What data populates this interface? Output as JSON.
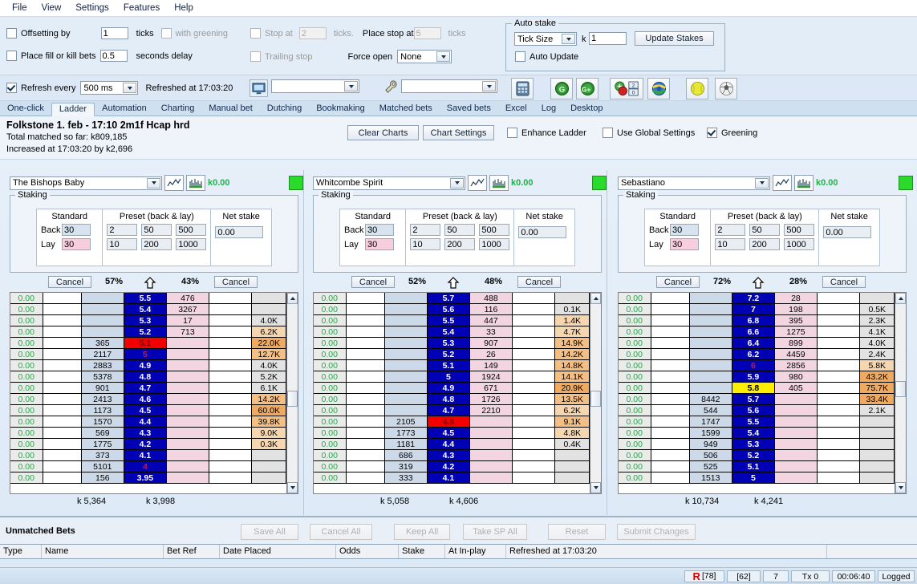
{
  "menu": [
    "File",
    "View",
    "Settings",
    "Features",
    "Help"
  ],
  "options": {
    "offsetting_label": "Offsetting by",
    "offsetting_value": "1",
    "ticks_label": "ticks",
    "with_greening_label": "with greening",
    "fillkill_label": "Place fill or kill bets",
    "fillkill_value": "0.5",
    "seconds_delay_label": "seconds delay",
    "stop_at_label": "Stop at",
    "stop_at_value": "2",
    "ticks_label2": "ticks.",
    "place_stop_label": "Place stop at",
    "place_stop_value": "5",
    "ticks_label3": "ticks",
    "trailing_stop_label": "Trailing stop",
    "force_open_label": "Force open",
    "force_open_value": "None"
  },
  "auto_stake": {
    "caption": "Auto stake",
    "mode": "Tick Size",
    "k_label": "k",
    "k_value": "1",
    "update_button": "Update Stakes",
    "auto_update_label": "Auto Update"
  },
  "refresh": {
    "refresh_every_label": "Refresh every",
    "interval": "500 ms",
    "refreshed_label": "Refreshed at 17:03:20",
    "combo1": "",
    "combo2": ""
  },
  "toolbar_icons": [
    "calculator-icon",
    "greening-g-icon",
    "greening-gplus-icon",
    "back-lay-icon",
    "stack-2-icon",
    "stack-0-icon",
    "globe-icon",
    "tennis-ball-icon",
    "football-icon"
  ],
  "tabs": [
    {
      "label": "One-click",
      "selected": false
    },
    {
      "label": "Ladder",
      "selected": true
    },
    {
      "label": "Automation",
      "selected": false
    },
    {
      "label": "Charting",
      "selected": false
    },
    {
      "label": "Manual bet",
      "selected": false
    },
    {
      "label": "Dutching",
      "selected": false
    },
    {
      "label": "Bookmaking",
      "selected": false
    },
    {
      "label": "Matched bets",
      "selected": false
    },
    {
      "label": "Saved bets",
      "selected": false
    },
    {
      "label": "Excel",
      "selected": false
    },
    {
      "label": "Log",
      "selected": false
    },
    {
      "label": "Desktop",
      "selected": false
    }
  ],
  "market": {
    "title": "Folkstone 1. feb - 17:10 2m1f Hcap hrd",
    "total_matched": "Total matched so far: k809,185",
    "increased": "Increased at 17:03:20 by k2,696",
    "clear_charts": "Clear Charts",
    "chart_settings": "Chart Settings",
    "enhance_ladder": "Enhance Ladder",
    "use_global_settings": "Use Global Settings",
    "greening": "Greening"
  },
  "staking_labels": {
    "caption": "Staking",
    "standard": "Standard",
    "preset": "Preset (back & lay)",
    "net_stake": "Net stake",
    "back": "Back",
    "lay": "Lay",
    "cancel": "Cancel"
  },
  "ladders": [
    {
      "selection": "The Bishops Baby",
      "pl": "k0.00",
      "back_pct": "57%",
      "lay_pct": "43%",
      "total_back": "k 5,364",
      "total_lay": "k 3,998",
      "staking": {
        "back": "30",
        "lay": "30",
        "p1": "2",
        "p2": "50",
        "p3": "500",
        "p4": "10",
        "p5": "200",
        "p6": "1000",
        "net": "0.00"
      },
      "rows": [
        {
          "pl": "0.00",
          "b2": "",
          "backq": "",
          "odds": "5.5",
          "layq": "476",
          "l2": "",
          "vol": "",
          "state": "blue",
          "volshade": 0
        },
        {
          "pl": "0.00",
          "b2": "",
          "backq": "",
          "odds": "5.4",
          "layq": "3267",
          "l2": "",
          "vol": "",
          "state": "blue",
          "volshade": 0
        },
        {
          "pl": "0.00",
          "b2": "",
          "backq": "",
          "odds": "5.3",
          "layq": "17",
          "l2": "",
          "vol": "4.0K",
          "state": "blue",
          "volshade": 0
        },
        {
          "pl": "0.00",
          "b2": "",
          "backq": "",
          "odds": "5.2",
          "layq": "713",
          "l2": "",
          "vol": "6.2K",
          "state": "blue",
          "volshade": 1
        },
        {
          "pl": "0.00",
          "b2": "",
          "backq": "365",
          "odds": "5.1",
          "layq": "",
          "l2": "",
          "vol": "22.0K",
          "state": "red",
          "volshade": 3
        },
        {
          "pl": "0.00",
          "b2": "",
          "backq": "2117",
          "odds": "5",
          "layq": "",
          "l2": "",
          "vol": "12.7K",
          "state": "mag",
          "volshade": 2
        },
        {
          "pl": "0.00",
          "b2": "",
          "backq": "2883",
          "odds": "4.9",
          "layq": "",
          "l2": "",
          "vol": "4.0K",
          "state": "blue",
          "volshade": 0
        },
        {
          "pl": "0.00",
          "b2": "",
          "backq": "5378",
          "odds": "4.8",
          "layq": "",
          "l2": "",
          "vol": "5.2K",
          "state": "blue",
          "volshade": 0
        },
        {
          "pl": "0.00",
          "b2": "",
          "backq": "901",
          "odds": "4.7",
          "layq": "",
          "l2": "",
          "vol": "6.1K",
          "state": "blue",
          "volshade": 0
        },
        {
          "pl": "0.00",
          "b2": "",
          "backq": "2413",
          "odds": "4.6",
          "layq": "",
          "l2": "",
          "vol": "14.2K",
          "state": "blue",
          "volshade": 2
        },
        {
          "pl": "0.00",
          "b2": "",
          "backq": "1173",
          "odds": "4.5",
          "layq": "",
          "l2": "",
          "vol": "60.0K",
          "state": "blue",
          "volshade": 3
        },
        {
          "pl": "0.00",
          "b2": "",
          "backq": "1570",
          "odds": "4.4",
          "layq": "",
          "l2": "",
          "vol": "39.8K",
          "state": "blue",
          "volshade": 2
        },
        {
          "pl": "0.00",
          "b2": "",
          "backq": "569",
          "odds": "4.3",
          "layq": "",
          "l2": "",
          "vol": "9.0K",
          "state": "blue",
          "volshade": 1
        },
        {
          "pl": "0.00",
          "b2": "",
          "backq": "1775",
          "odds": "4.2",
          "layq": "",
          "l2": "",
          "vol": "0.3K",
          "state": "blue",
          "volshade": 1
        },
        {
          "pl": "0.00",
          "b2": "",
          "backq": "373",
          "odds": "4.1",
          "layq": "",
          "l2": "",
          "vol": "",
          "state": "blue",
          "volshade": 0
        },
        {
          "pl": "0.00",
          "b2": "",
          "backq": "5101",
          "odds": "4",
          "layq": "",
          "l2": "",
          "vol": "",
          "state": "mag",
          "volshade": 0
        },
        {
          "pl": "0.00",
          "b2": "",
          "backq": "156",
          "odds": "3.95",
          "layq": "",
          "l2": "",
          "vol": "",
          "state": "blue",
          "volshade": 0
        }
      ]
    },
    {
      "selection": "Whitcombe Spirit",
      "pl": "k0.00",
      "back_pct": "52%",
      "lay_pct": "48%",
      "total_back": "k 5,058",
      "total_lay": "k 4,606",
      "staking": {
        "back": "30",
        "lay": "30",
        "p1": "2",
        "p2": "50",
        "p3": "500",
        "p4": "10",
        "p5": "200",
        "p6": "1000",
        "net": "0.00"
      },
      "rows": [
        {
          "pl": "0.00",
          "b2": "",
          "backq": "",
          "odds": "5.7",
          "layq": "488",
          "l2": "",
          "vol": "",
          "state": "blue",
          "volshade": 0
        },
        {
          "pl": "0.00",
          "b2": "",
          "backq": "",
          "odds": "5.6",
          "layq": "116",
          "l2": "",
          "vol": "0.1K",
          "state": "blue",
          "volshade": 0
        },
        {
          "pl": "0.00",
          "b2": "",
          "backq": "",
          "odds": "5.5",
          "layq": "447",
          "l2": "",
          "vol": "1.4K",
          "state": "blue",
          "volshade": 1
        },
        {
          "pl": "0.00",
          "b2": "",
          "backq": "",
          "odds": "5.4",
          "layq": "33",
          "l2": "",
          "vol": "4.7K",
          "state": "blue",
          "volshade": 1
        },
        {
          "pl": "0.00",
          "b2": "",
          "backq": "",
          "odds": "5.3",
          "layq": "907",
          "l2": "",
          "vol": "14.9K",
          "state": "blue",
          "volshade": 2
        },
        {
          "pl": "0.00",
          "b2": "",
          "backq": "",
          "odds": "5.2",
          "layq": "26",
          "l2": "",
          "vol": "14.2K",
          "state": "blue",
          "volshade": 2
        },
        {
          "pl": "0.00",
          "b2": "",
          "backq": "",
          "odds": "5.1",
          "layq": "149",
          "l2": "",
          "vol": "14.8K",
          "state": "blue",
          "volshade": 2
        },
        {
          "pl": "0.00",
          "b2": "",
          "backq": "",
          "odds": "5",
          "layq": "1924",
          "l2": "",
          "vol": "14.1K",
          "state": "blue",
          "volshade": 2
        },
        {
          "pl": "0.00",
          "b2": "",
          "backq": "",
          "odds": "4.9",
          "layq": "671",
          "l2": "",
          "vol": "20.9K",
          "state": "blue",
          "volshade": 3
        },
        {
          "pl": "0.00",
          "b2": "",
          "backq": "",
          "odds": "4.8",
          "layq": "1726",
          "l2": "",
          "vol": "13.5K",
          "state": "blue",
          "volshade": 2
        },
        {
          "pl": "0.00",
          "b2": "",
          "backq": "",
          "odds": "4.7",
          "layq": "2210",
          "l2": "",
          "vol": "6.2K",
          "state": "blue",
          "volshade": 1
        },
        {
          "pl": "0.00",
          "b2": "",
          "backq": "2105",
          "odds": "4.6",
          "layq": "",
          "l2": "",
          "vol": "9.1K",
          "state": "red",
          "volshade": 2
        },
        {
          "pl": "0.00",
          "b2": "",
          "backq": "1773",
          "odds": "4.5",
          "layq": "",
          "l2": "",
          "vol": "4.8K",
          "state": "blue",
          "volshade": 1
        },
        {
          "pl": "0.00",
          "b2": "",
          "backq": "1181",
          "odds": "4.4",
          "layq": "",
          "l2": "",
          "vol": "0.4K",
          "state": "blue",
          "volshade": 0
        },
        {
          "pl": "0.00",
          "b2": "",
          "backq": "686",
          "odds": "4.3",
          "layq": "",
          "l2": "",
          "vol": "",
          "state": "blue",
          "volshade": 0
        },
        {
          "pl": "0.00",
          "b2": "",
          "backq": "319",
          "odds": "4.2",
          "layq": "",
          "l2": "",
          "vol": "",
          "state": "blue",
          "volshade": 0
        },
        {
          "pl": "0.00",
          "b2": "",
          "backq": "333",
          "odds": "4.1",
          "layq": "",
          "l2": "",
          "vol": "",
          "state": "blue",
          "volshade": 0
        }
      ]
    },
    {
      "selection": "Sebastiano",
      "pl": "k0.00",
      "back_pct": "72%",
      "lay_pct": "28%",
      "total_back": "k 10,734",
      "total_lay": "k 4,241",
      "staking": {
        "back": "30",
        "lay": "30",
        "p1": "2",
        "p2": "50",
        "p3": "500",
        "p4": "10",
        "p5": "200",
        "p6": "1000",
        "net": "0.00"
      },
      "rows": [
        {
          "pl": "0.00",
          "b2": "",
          "backq": "",
          "odds": "7.2",
          "layq": "28",
          "l2": "",
          "vol": "",
          "state": "blue",
          "volshade": 0
        },
        {
          "pl": "0.00",
          "b2": "",
          "backq": "",
          "odds": "7",
          "layq": "198",
          "l2": "",
          "vol": "0.5K",
          "state": "blue",
          "volshade": 0
        },
        {
          "pl": "0.00",
          "b2": "",
          "backq": "",
          "odds": "6.8",
          "layq": "395",
          "l2": "",
          "vol": "2.3K",
          "state": "blue",
          "volshade": 0
        },
        {
          "pl": "0.00",
          "b2": "",
          "backq": "",
          "odds": "6.6",
          "layq": "1275",
          "l2": "",
          "vol": "4.1K",
          "state": "blue",
          "volshade": 0
        },
        {
          "pl": "0.00",
          "b2": "",
          "backq": "",
          "odds": "6.4",
          "layq": "899",
          "l2": "",
          "vol": "4.0K",
          "state": "blue",
          "volshade": 0
        },
        {
          "pl": "0.00",
          "b2": "",
          "backq": "",
          "odds": "6.2",
          "layq": "4459",
          "l2": "",
          "vol": "2.4K",
          "state": "blue",
          "volshade": 0
        },
        {
          "pl": "0.00",
          "b2": "",
          "backq": "",
          "odds": "6",
          "layq": "2856",
          "l2": "",
          "vol": "5.8K",
          "state": "mag",
          "volshade": 1
        },
        {
          "pl": "0.00",
          "b2": "",
          "backq": "",
          "odds": "5.9",
          "layq": "980",
          "l2": "",
          "vol": "43.2K",
          "state": "blue",
          "volshade": 3
        },
        {
          "pl": "0.00",
          "b2": "",
          "backq": "",
          "odds": "5.8",
          "layq": "405",
          "l2": "",
          "vol": "75.7K",
          "state": "yellow",
          "volshade": 3
        },
        {
          "pl": "0.00",
          "b2": "",
          "backq": "8442",
          "odds": "5.7",
          "layq": "",
          "l2": "",
          "vol": "33.4K",
          "state": "blue",
          "volshade": 3
        },
        {
          "pl": "0.00",
          "b2": "",
          "backq": "544",
          "odds": "5.6",
          "layq": "",
          "l2": "",
          "vol": "2.1K",
          "state": "blue",
          "volshade": 0
        },
        {
          "pl": "0.00",
          "b2": "",
          "backq": "1747",
          "odds": "5.5",
          "layq": "",
          "l2": "",
          "vol": "",
          "state": "blue",
          "volshade": 0
        },
        {
          "pl": "0.00",
          "b2": "",
          "backq": "1599",
          "odds": "5.4",
          "layq": "",
          "l2": "",
          "vol": "",
          "state": "blue",
          "volshade": 0
        },
        {
          "pl": "0.00",
          "b2": "",
          "backq": "949",
          "odds": "5.3",
          "layq": "",
          "l2": "",
          "vol": "",
          "state": "blue",
          "volshade": 0
        },
        {
          "pl": "0.00",
          "b2": "",
          "backq": "506",
          "odds": "5.2",
          "layq": "",
          "l2": "",
          "vol": "",
          "state": "blue",
          "volshade": 0
        },
        {
          "pl": "0.00",
          "b2": "",
          "backq": "525",
          "odds": "5.1",
          "layq": "",
          "l2": "",
          "vol": "",
          "state": "blue",
          "volshade": 0
        },
        {
          "pl": "0.00",
          "b2": "",
          "backq": "1513",
          "odds": "5",
          "layq": "",
          "l2": "",
          "vol": "",
          "state": "blue",
          "volshade": 0
        }
      ]
    }
  ],
  "unmatched": {
    "title": "Unmatched Bets",
    "buttons": [
      "Save All",
      "Cancel All",
      "Keep All",
      "Take SP All",
      "Reset",
      "Submit Changes"
    ],
    "columns": [
      "Type",
      "Name",
      "Bet Ref",
      "Date Placed",
      "Odds",
      "Stake",
      "At In-play",
      "Refreshed at 17:03:20"
    ]
  },
  "status": {
    "r_flag": "R",
    "r_count": "[78]",
    "count2": "[62]",
    "count3": "7",
    "tx": "Tx 0",
    "timer": "00:06:40",
    "logged": "Logged"
  }
}
